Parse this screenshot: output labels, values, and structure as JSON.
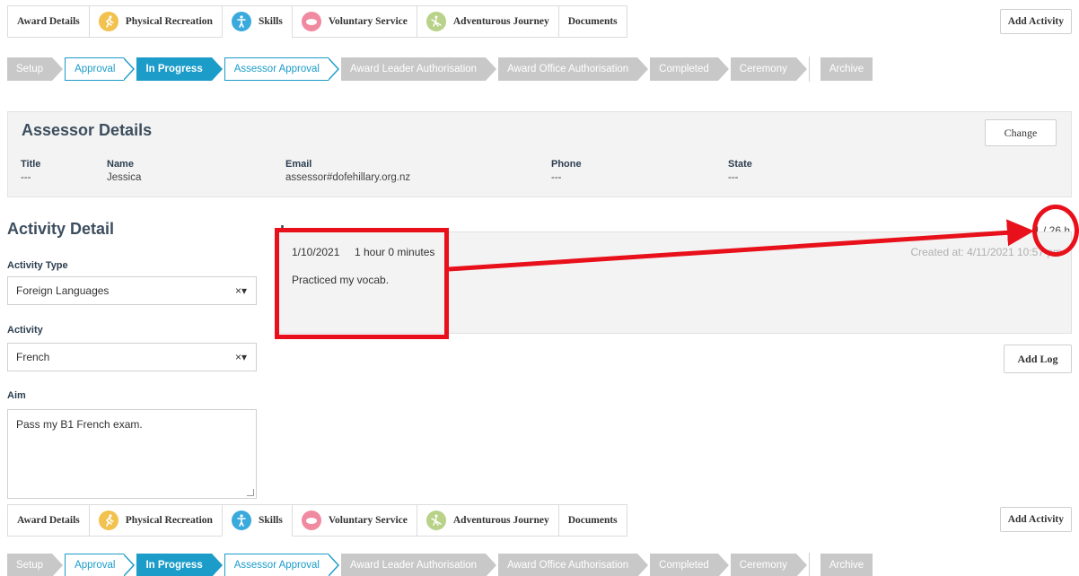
{
  "tabs": [
    {
      "label": "Award Details",
      "icon": "",
      "color": ""
    },
    {
      "label": "Physical Recreation",
      "icon": "runner-icon",
      "color": "#f2c14e"
    },
    {
      "label": "Skills",
      "icon": "person-icon",
      "color": "#3aa9dc"
    },
    {
      "label": "Voluntary Service",
      "icon": "heart-hands-icon",
      "color": "#f08aa0"
    },
    {
      "label": "Adventurous Journey",
      "icon": "hiker-icon",
      "color": "#b9d28a"
    },
    {
      "label": "Documents",
      "icon": "",
      "color": ""
    }
  ],
  "add_activity_label": "Add Activity",
  "stepper": [
    {
      "label": "Setup",
      "state": "gray"
    },
    {
      "label": "Approval",
      "state": "done"
    },
    {
      "label": "In Progress",
      "state": "active"
    },
    {
      "label": "Assessor Approval",
      "state": "done"
    },
    {
      "label": "Award Leader Authorisation",
      "state": "gray"
    },
    {
      "label": "Award Office Authorisation",
      "state": "gray"
    },
    {
      "label": "Completed",
      "state": "gray"
    },
    {
      "label": "Ceremony",
      "state": "gray"
    },
    {
      "label": "Archive",
      "state": "gray"
    }
  ],
  "assessor": {
    "title": "Assessor Details",
    "change_label": "Change",
    "fields": [
      {
        "label": "Title",
        "value": "---"
      },
      {
        "label": "Name",
        "value": "Jessica"
      },
      {
        "label": "Email",
        "value": "assessor#dofehillary.org.nz"
      },
      {
        "label": "Phone",
        "value": "---"
      },
      {
        "label": "State",
        "value": "---"
      }
    ]
  },
  "activity_detail": {
    "title": "Activity Detail",
    "type_label": "Activity Type",
    "type_value": "Foreign Languages",
    "activity_label": "Activity",
    "activity_value": "French",
    "aim_label": "Aim",
    "aim_value": "Pass my B1 French exam."
  },
  "logs": {
    "title": "Logs",
    "hours": "1 / 26 h",
    "entries": [
      {
        "date": "1/10/2021",
        "duration": "1 hour  0 minutes",
        "created": "Created at: 4/11/2021 10:57 pm",
        "text": "Practiced my vocab."
      }
    ],
    "add_log_label": "Add Log"
  },
  "colors": {
    "accent": "#1c9cc9",
    "annotation": "#e8101a",
    "step_gray": "#c8c8c8"
  }
}
